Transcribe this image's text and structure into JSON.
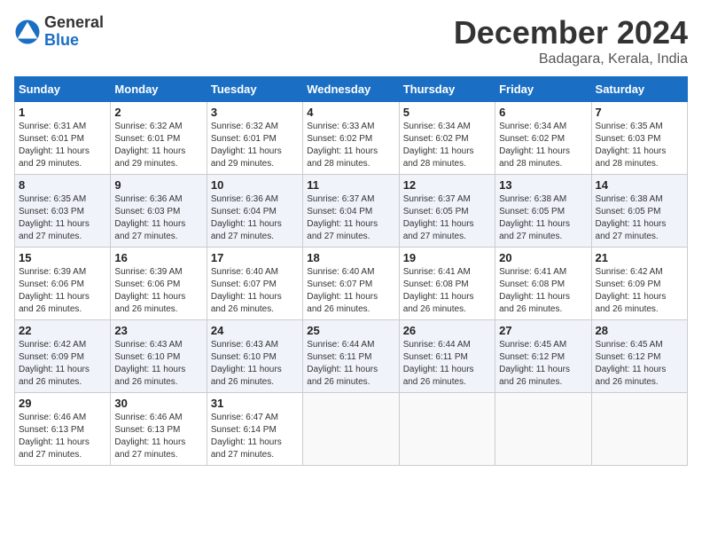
{
  "header": {
    "logo_general": "General",
    "logo_blue": "Blue",
    "month_title": "December 2024",
    "location": "Badagara, Kerala, India"
  },
  "weekdays": [
    "Sunday",
    "Monday",
    "Tuesday",
    "Wednesday",
    "Thursday",
    "Friday",
    "Saturday"
  ],
  "weeks": [
    [
      {
        "day": "1",
        "info": "Sunrise: 6:31 AM\nSunset: 6:01 PM\nDaylight: 11 hours\nand 29 minutes."
      },
      {
        "day": "2",
        "info": "Sunrise: 6:32 AM\nSunset: 6:01 PM\nDaylight: 11 hours\nand 29 minutes."
      },
      {
        "day": "3",
        "info": "Sunrise: 6:32 AM\nSunset: 6:01 PM\nDaylight: 11 hours\nand 29 minutes."
      },
      {
        "day": "4",
        "info": "Sunrise: 6:33 AM\nSunset: 6:02 PM\nDaylight: 11 hours\nand 28 minutes."
      },
      {
        "day": "5",
        "info": "Sunrise: 6:34 AM\nSunset: 6:02 PM\nDaylight: 11 hours\nand 28 minutes."
      },
      {
        "day": "6",
        "info": "Sunrise: 6:34 AM\nSunset: 6:02 PM\nDaylight: 11 hours\nand 28 minutes."
      },
      {
        "day": "7",
        "info": "Sunrise: 6:35 AM\nSunset: 6:03 PM\nDaylight: 11 hours\nand 28 minutes."
      }
    ],
    [
      {
        "day": "8",
        "info": "Sunrise: 6:35 AM\nSunset: 6:03 PM\nDaylight: 11 hours\nand 27 minutes."
      },
      {
        "day": "9",
        "info": "Sunrise: 6:36 AM\nSunset: 6:03 PM\nDaylight: 11 hours\nand 27 minutes."
      },
      {
        "day": "10",
        "info": "Sunrise: 6:36 AM\nSunset: 6:04 PM\nDaylight: 11 hours\nand 27 minutes."
      },
      {
        "day": "11",
        "info": "Sunrise: 6:37 AM\nSunset: 6:04 PM\nDaylight: 11 hours\nand 27 minutes."
      },
      {
        "day": "12",
        "info": "Sunrise: 6:37 AM\nSunset: 6:05 PM\nDaylight: 11 hours\nand 27 minutes."
      },
      {
        "day": "13",
        "info": "Sunrise: 6:38 AM\nSunset: 6:05 PM\nDaylight: 11 hours\nand 27 minutes."
      },
      {
        "day": "14",
        "info": "Sunrise: 6:38 AM\nSunset: 6:05 PM\nDaylight: 11 hours\nand 27 minutes."
      }
    ],
    [
      {
        "day": "15",
        "info": "Sunrise: 6:39 AM\nSunset: 6:06 PM\nDaylight: 11 hours\nand 26 minutes."
      },
      {
        "day": "16",
        "info": "Sunrise: 6:39 AM\nSunset: 6:06 PM\nDaylight: 11 hours\nand 26 minutes."
      },
      {
        "day": "17",
        "info": "Sunrise: 6:40 AM\nSunset: 6:07 PM\nDaylight: 11 hours\nand 26 minutes."
      },
      {
        "day": "18",
        "info": "Sunrise: 6:40 AM\nSunset: 6:07 PM\nDaylight: 11 hours\nand 26 minutes."
      },
      {
        "day": "19",
        "info": "Sunrise: 6:41 AM\nSunset: 6:08 PM\nDaylight: 11 hours\nand 26 minutes."
      },
      {
        "day": "20",
        "info": "Sunrise: 6:41 AM\nSunset: 6:08 PM\nDaylight: 11 hours\nand 26 minutes."
      },
      {
        "day": "21",
        "info": "Sunrise: 6:42 AM\nSunset: 6:09 PM\nDaylight: 11 hours\nand 26 minutes."
      }
    ],
    [
      {
        "day": "22",
        "info": "Sunrise: 6:42 AM\nSunset: 6:09 PM\nDaylight: 11 hours\nand 26 minutes."
      },
      {
        "day": "23",
        "info": "Sunrise: 6:43 AM\nSunset: 6:10 PM\nDaylight: 11 hours\nand 26 minutes."
      },
      {
        "day": "24",
        "info": "Sunrise: 6:43 AM\nSunset: 6:10 PM\nDaylight: 11 hours\nand 26 minutes."
      },
      {
        "day": "25",
        "info": "Sunrise: 6:44 AM\nSunset: 6:11 PM\nDaylight: 11 hours\nand 26 minutes."
      },
      {
        "day": "26",
        "info": "Sunrise: 6:44 AM\nSunset: 6:11 PM\nDaylight: 11 hours\nand 26 minutes."
      },
      {
        "day": "27",
        "info": "Sunrise: 6:45 AM\nSunset: 6:12 PM\nDaylight: 11 hours\nand 26 minutes."
      },
      {
        "day": "28",
        "info": "Sunrise: 6:45 AM\nSunset: 6:12 PM\nDaylight: 11 hours\nand 26 minutes."
      }
    ],
    [
      {
        "day": "29",
        "info": "Sunrise: 6:46 AM\nSunset: 6:13 PM\nDaylight: 11 hours\nand 27 minutes."
      },
      {
        "day": "30",
        "info": "Sunrise: 6:46 AM\nSunset: 6:13 PM\nDaylight: 11 hours\nand 27 minutes."
      },
      {
        "day": "31",
        "info": "Sunrise: 6:47 AM\nSunset: 6:14 PM\nDaylight: 11 hours\nand 27 minutes."
      },
      {
        "day": "",
        "info": ""
      },
      {
        "day": "",
        "info": ""
      },
      {
        "day": "",
        "info": ""
      },
      {
        "day": "",
        "info": ""
      }
    ]
  ]
}
